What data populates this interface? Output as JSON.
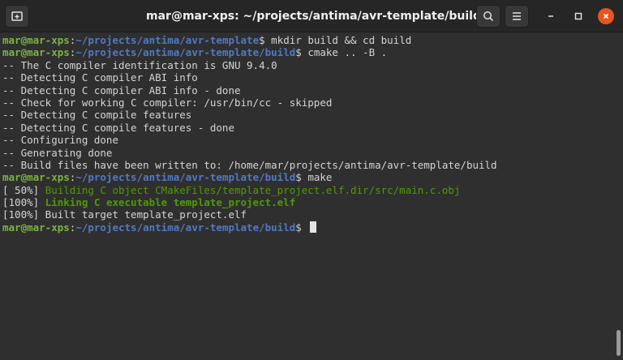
{
  "window": {
    "title": "mar@mar-xps: ~/projects/antima/avr-template/build"
  },
  "titlebar": {
    "new_tab_icon": "new-tab-icon",
    "search_icon": "search-icon",
    "menu_icon": "hamburger-menu-icon",
    "minimize_icon": "minimize-icon",
    "maximize_icon": "maximize-icon",
    "close_icon": "close-icon"
  },
  "colors": {
    "prompt_user": "#7cb342",
    "prompt_path": "#5079c4",
    "output_green": "#4e9a06",
    "close_button": "#e95420"
  },
  "terminal": {
    "prompt1": {
      "user": "mar@mar-xps",
      "sep": ":",
      "path": "~/projects/antima/avr-template",
      "dollar": "$",
      "command": " mkdir build && cd build"
    },
    "prompt2": {
      "user": "mar@mar-xps",
      "sep": ":",
      "path": "~/projects/antima/avr-template/build",
      "dollar": "$",
      "command": " cmake .. -B ."
    },
    "cmake_output": [
      "-- The C compiler identification is GNU 9.4.0",
      "-- Detecting C compiler ABI info",
      "-- Detecting C compiler ABI info - done",
      "-- Check for working C compiler: /usr/bin/cc - skipped",
      "-- Detecting C compile features",
      "-- Detecting C compile features - done",
      "-- Configuring done",
      "-- Generating done",
      "-- Build files have been written to: /home/mar/projects/antima/avr-template/build"
    ],
    "prompt3": {
      "user": "mar@mar-xps",
      "sep": ":",
      "path": "~/projects/antima/avr-template/build",
      "dollar": "$",
      "command": " make"
    },
    "make_output": {
      "line1_progress": "[ 50%] ",
      "line1_text": "Building C object CMakeFiles/template_project.elf.dir/src/main.c.obj",
      "line2_progress": "[100%] ",
      "line2_text": "Linking C executable template_project.elf",
      "line3": "[100%] Built target template_project.elf"
    },
    "prompt4": {
      "user": "mar@mar-xps",
      "sep": ":",
      "path": "~/projects/antima/avr-template/build",
      "dollar": "$",
      "command": " "
    }
  }
}
